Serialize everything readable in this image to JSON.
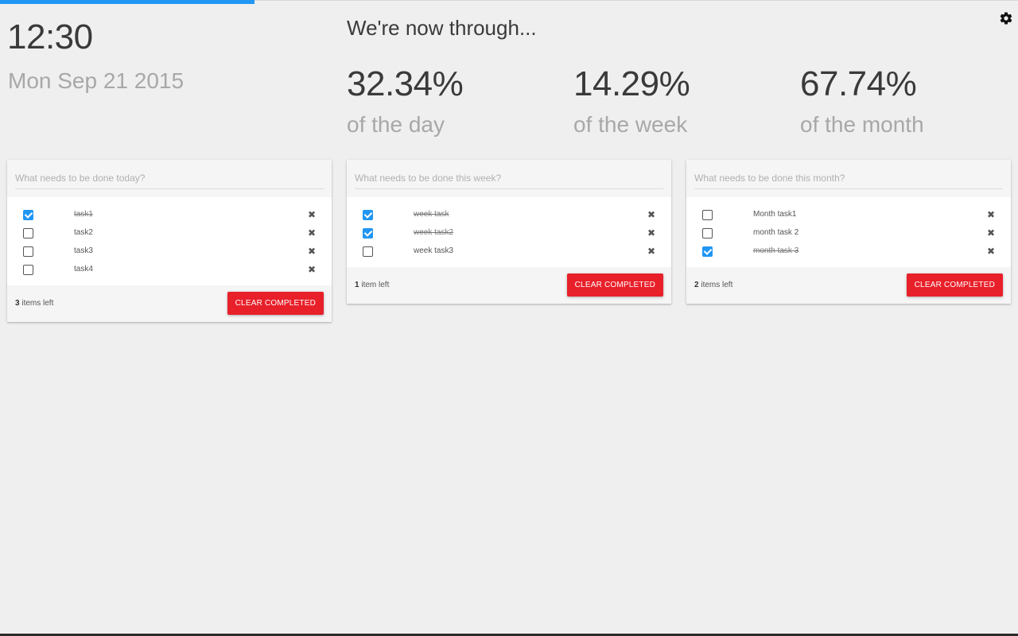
{
  "progress": {
    "fraction": 0.25,
    "color": "#2196f3"
  },
  "settings": {
    "icon": "gear-icon"
  },
  "clock": {
    "time": "12:30",
    "date": "Mon Sep 21 2015"
  },
  "through": {
    "heading": "We're now through...",
    "stats": [
      {
        "value": "32.34%",
        "label": "of the day"
      },
      {
        "value": "14.29%",
        "label": "of the week"
      },
      {
        "value": "67.74%",
        "label": "of the month"
      }
    ]
  },
  "lists": [
    {
      "placeholder": "What needs to be done today?",
      "tasks": [
        {
          "text": "task1",
          "done": true
        },
        {
          "text": "task2",
          "done": false
        },
        {
          "text": "task3",
          "done": false
        },
        {
          "text": "task4",
          "done": false
        }
      ],
      "count": "3",
      "count_suffix": "items left",
      "clear_label": "CLEAR COMPLETED"
    },
    {
      "placeholder": "What needs to be done this week?",
      "tasks": [
        {
          "text": "week task",
          "done": true
        },
        {
          "text": "week task2",
          "done": true
        },
        {
          "text": "week task3",
          "done": false
        }
      ],
      "count": "1",
      "count_suffix": "item left",
      "clear_label": "CLEAR COMPLETED"
    },
    {
      "placeholder": "What needs to be done this month?",
      "tasks": [
        {
          "text": "Month task1",
          "done": false
        },
        {
          "text": "month task 2",
          "done": false
        },
        {
          "text": "month task 3",
          "done": true
        }
      ],
      "count": "2",
      "count_suffix": "items left",
      "clear_label": "CLEAR COMPLETED"
    }
  ],
  "colors": {
    "accent": "#2196f3",
    "danger": "#e8202a",
    "background": "#efefef"
  }
}
